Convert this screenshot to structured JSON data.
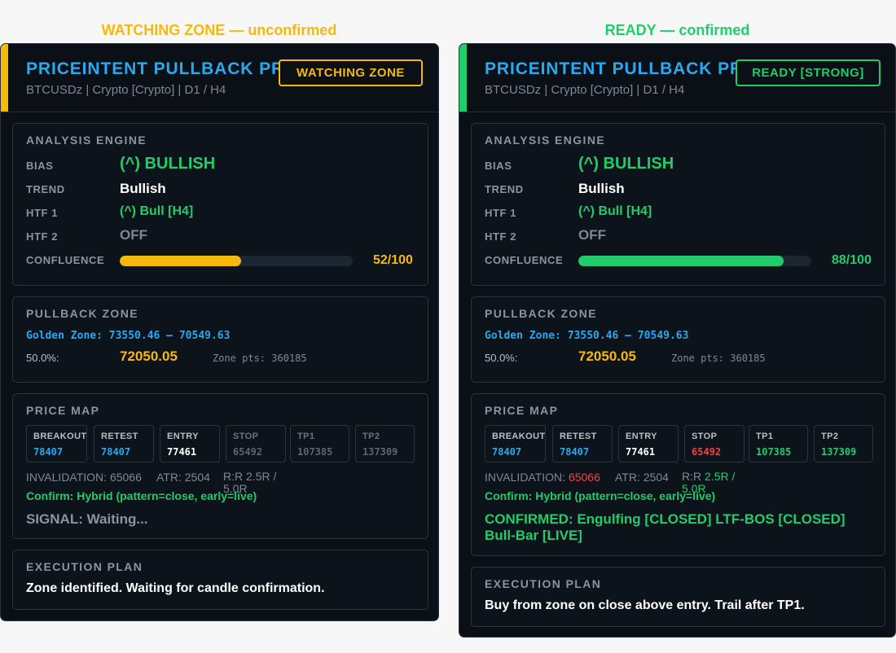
{
  "captions": {
    "left": "WATCHING ZONE — unconfirmed",
    "right": "READY — confirmed"
  },
  "colors": {
    "amber": "#f5b80c",
    "green": "#22cc6b",
    "blue": "#29a9ee",
    "red": "#ef4444",
    "panel_bg": "#0b1017"
  },
  "left": {
    "title": "PRICEINTENT PULLBACK PRO v2.1",
    "subtitle": "BTCUSDz | Crypto [Crypto] | D1 / H4",
    "badge": "WATCHING ZONE",
    "analysis": {
      "section_title": "ANALYSIS ENGINE",
      "bias_label": "BIAS",
      "bias_value": "(^) BULLISH",
      "trend_label": "TREND",
      "trend_value": "Bullish",
      "htf1_label": "HTF 1",
      "htf1_value": "(^) Bull [H4]",
      "htf2_label": "HTF 2",
      "htf2_value": "OFF",
      "confluence_label": "CONFLUENCE",
      "confluence_value": 52,
      "confluence_text": "52/100"
    },
    "pullback": {
      "section_title": "PULLBACK ZONE",
      "golden": "Golden Zone: 73550.46 – 70549.63",
      "fib_label": "50.0%:",
      "fib_value": "72050.05",
      "zone_pts": "Zone pts: 360185"
    },
    "price_map": {
      "section_title": "PRICE MAP",
      "boxes": [
        {
          "label": "BREAKOUT",
          "value": "78407",
          "color": "#29a9ee"
        },
        {
          "label": "RETEST",
          "value": "78407",
          "color": "#29a9ee"
        },
        {
          "label": "ENTRY",
          "value": "77461",
          "color": "#ffffff"
        },
        {
          "label": "STOP",
          "value": "65492",
          "color": "#5c6573"
        },
        {
          "label": "TP1",
          "value": "107385",
          "color": "#5c6573"
        },
        {
          "label": "TP2",
          "value": "137309",
          "color": "#5c6573"
        }
      ],
      "invalidation_label": "INVALIDATION:",
      "invalidation_value": "65066",
      "atr": "ATR: 2504",
      "rr_label": "R:R",
      "rr_value": "2.5R / 5.0R",
      "confirm": "Confirm: Hybrid (pattern=close, early=live)",
      "signal": "SIGNAL: Waiting..."
    },
    "execution": {
      "section_title": "EXECUTION PLAN",
      "text": "Zone identified. Waiting for candle confirmation."
    }
  },
  "right": {
    "title": "PRICEINTENT PULLBACK PRO v2.1",
    "subtitle": "BTCUSDz | Crypto [Crypto] | D1 / H4",
    "badge": "READY [STRONG]",
    "analysis": {
      "section_title": "ANALYSIS ENGINE",
      "bias_label": "BIAS",
      "bias_value": "(^) BULLISH",
      "trend_label": "TREND",
      "trend_value": "Bullish",
      "htf1_label": "HTF 1",
      "htf1_value": "(^) Bull [H4]",
      "htf2_label": "HTF 2",
      "htf2_value": "OFF",
      "confluence_label": "CONFLUENCE",
      "confluence_value": 88,
      "confluence_text": "88/100"
    },
    "pullback": {
      "section_title": "PULLBACK ZONE",
      "golden": "Golden Zone: 73550.46 – 70549.63",
      "fib_label": "50.0%:",
      "fib_value": "72050.05",
      "zone_pts": "Zone pts: 360185"
    },
    "price_map": {
      "section_title": "PRICE MAP",
      "boxes": [
        {
          "label": "BREAKOUT",
          "value": "78407",
          "color": "#29a9ee"
        },
        {
          "label": "RETEST",
          "value": "78407",
          "color": "#29a9ee"
        },
        {
          "label": "ENTRY",
          "value": "77461",
          "color": "#ffffff"
        },
        {
          "label": "STOP",
          "value": "65492",
          "color": "#ef4444"
        },
        {
          "label": "TP1",
          "value": "107385",
          "color": "#22cc6b"
        },
        {
          "label": "TP2",
          "value": "137309",
          "color": "#22cc6b"
        }
      ],
      "invalidation_label": "INVALIDATION:",
      "invalidation_value": "65066",
      "atr": "ATR: 2504",
      "rr_label": "R:R",
      "rr_value": "2.5R / 5.0R",
      "confirm": "Confirm: Hybrid (pattern=close, early=live)",
      "signal": "CONFIRMED: Engulfing [CLOSED] LTF-BOS [CLOSED] Bull-Bar [LIVE]"
    },
    "execution": {
      "section_title": "EXECUTION PLAN",
      "text": "Buy from zone on close above entry. Trail after TP1."
    }
  }
}
